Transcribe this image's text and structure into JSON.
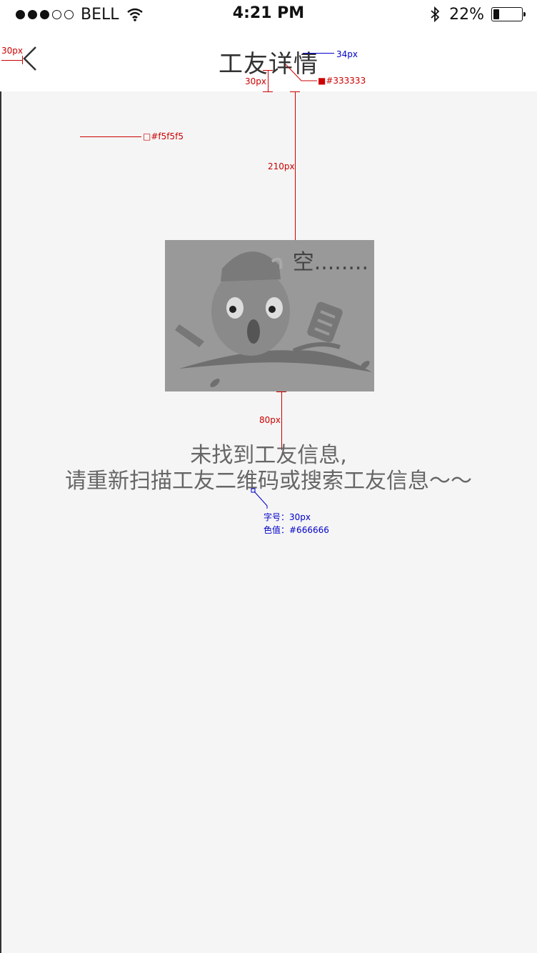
{
  "status_bar": {
    "carrier": "BELL",
    "time": "4:21 PM",
    "battery": "22%",
    "battery_level": 0.22
  },
  "navbar": {
    "title": "工友详情",
    "back_icon": "chevron-left-icon"
  },
  "empty_state": {
    "illustration_label": "空........",
    "message_line1": "未找到工友信息,",
    "message_line2": "请重新扫描工友二维码或搜索工友信息～～"
  },
  "annotations": {
    "left_margin": "30px",
    "title_font": "34px",
    "title_gap": "30px",
    "title_color": "■#333333",
    "bg_color": "□#f5f5f5",
    "top_spacing": "210px",
    "bottom_spacing": "80px",
    "font_size": "字号：30px",
    "font_color": "色值：#666666"
  },
  "colors": {
    "background": "#f5f5f5",
    "title": "#333333",
    "message": "#666666"
  }
}
